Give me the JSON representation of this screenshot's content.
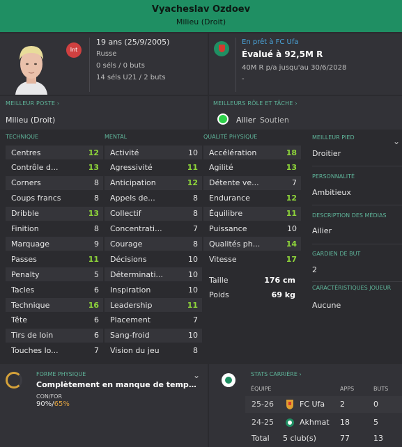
{
  "header": {
    "name": "Vyacheslav Ozdoev",
    "position": "Milieu (Droit)"
  },
  "personal": {
    "int_badge": "Int",
    "age_dob": "19 ans (25/9/2005)",
    "nationality": "Russe",
    "caps": "0 séls / 0 buts",
    "u21_caps": "14 séls U21 / 2 buts"
  },
  "contract": {
    "loan": "En prêt à FC Ufa",
    "value": "Évalué à 92,5M R",
    "wage": "40M R p/a jusqu'au 30/6/2028",
    "extra": "-"
  },
  "best_position": {
    "label": "MEILLEUR POSTE",
    "value": "Milieu (Droit)"
  },
  "best_role": {
    "label": "MEILLEURS RÔLE ET TÂCHE",
    "role": "Ailier",
    "duty": "Soutien"
  },
  "attributes": {
    "technique": {
      "title": "TECHNIQUE",
      "items": [
        {
          "name": "Centres",
          "value": "12",
          "hi": true
        },
        {
          "name": "Contrôle d...",
          "value": "13",
          "hi": true
        },
        {
          "name": "Corners",
          "value": "8",
          "hi": false
        },
        {
          "name": "Coups francs",
          "value": "8",
          "hi": false
        },
        {
          "name": "Dribble",
          "value": "13",
          "hi": true
        },
        {
          "name": "Finition",
          "value": "8",
          "hi": false
        },
        {
          "name": "Marquage",
          "value": "9",
          "hi": false
        },
        {
          "name": "Passes",
          "value": "11",
          "hi": true
        },
        {
          "name": "Penalty",
          "value": "5",
          "hi": false
        },
        {
          "name": "Tacles",
          "value": "6",
          "hi": false
        },
        {
          "name": "Technique",
          "value": "16",
          "hi": true
        },
        {
          "name": "Tête",
          "value": "6",
          "hi": false
        },
        {
          "name": "Tirs de loin",
          "value": "6",
          "hi": false
        },
        {
          "name": "Touches lo...",
          "value": "7",
          "hi": false
        }
      ]
    },
    "mental": {
      "title": "MENTAL",
      "items": [
        {
          "name": "Activité",
          "value": "10",
          "hi": false
        },
        {
          "name": "Agressivité",
          "value": "11",
          "hi": true
        },
        {
          "name": "Anticipation",
          "value": "12",
          "hi": true
        },
        {
          "name": "Appels de...",
          "value": "8",
          "hi": false
        },
        {
          "name": "Collectif",
          "value": "8",
          "hi": false
        },
        {
          "name": "Concentrati...",
          "value": "7",
          "hi": false
        },
        {
          "name": "Courage",
          "value": "8",
          "hi": false
        },
        {
          "name": "Décisions",
          "value": "10",
          "hi": false
        },
        {
          "name": "Déterminati...",
          "value": "10",
          "hi": false
        },
        {
          "name": "Inspiration",
          "value": "10",
          "hi": false
        },
        {
          "name": "Leadership",
          "value": "11",
          "hi": true
        },
        {
          "name": "Placement",
          "value": "7",
          "hi": false
        },
        {
          "name": "Sang-froid",
          "value": "10",
          "hi": false
        },
        {
          "name": "Vision du jeu",
          "value": "8",
          "hi": false
        }
      ]
    },
    "physical": {
      "title": "QUALITÉ PHYSIQUE",
      "items": [
        {
          "name": "Accélération",
          "value": "18",
          "hi": true
        },
        {
          "name": "Agilité",
          "value": "13",
          "hi": true
        },
        {
          "name": "Détente ve...",
          "value": "7",
          "hi": false
        },
        {
          "name": "Endurance",
          "value": "12",
          "hi": true
        },
        {
          "name": "Équilibre",
          "value": "11",
          "hi": true
        },
        {
          "name": "Puissance",
          "value": "10",
          "hi": false
        },
        {
          "name": "Qualités ph...",
          "value": "14",
          "hi": true
        },
        {
          "name": "Vitesse",
          "value": "17",
          "hi": true
        }
      ],
      "height_label": "Taille",
      "height": "176 cm",
      "weight_label": "Poids",
      "weight": "69 kg"
    }
  },
  "side": {
    "best_foot_label": "MEILLEUR PIED",
    "best_foot": "Droitier",
    "personality_label": "PERSONNALITÉ",
    "personality": "Ambitieux",
    "media_label": "DESCRIPTION DES MÉDIAS",
    "media": "Ailier",
    "gk_label": "GARDIEN DE BUT",
    "gk": "2",
    "traits_label": "CARACTÉRISTIQUES JOUEUR",
    "traits": "Aucune"
  },
  "form": {
    "label": "FORME PHYSIQUE",
    "status": "Complètement en manque de temps de j...",
    "confor_label": "CON/FOR",
    "condition": "90%",
    "sep": "/",
    "fitness": "65%"
  },
  "career": {
    "label": "STATS CARRIÈRE",
    "col_team": "ÉQUIPE",
    "col_apps": "APPS",
    "col_goals": "BUTS",
    "rows": [
      {
        "season": "25-26",
        "club": "FC Ufa",
        "apps": "2",
        "goals": "0"
      },
      {
        "season": "24-25",
        "club": "Akhmat",
        "apps": "18",
        "goals": "5"
      }
    ],
    "total_label": "Total",
    "total_clubs": "5 club(s)",
    "total_apps": "77",
    "total_goals": "13"
  },
  "colors": {
    "accent": "#1f8f63",
    "highlight": "#8fd63a",
    "link": "#4aa3d8",
    "section": "#5fb59a"
  }
}
